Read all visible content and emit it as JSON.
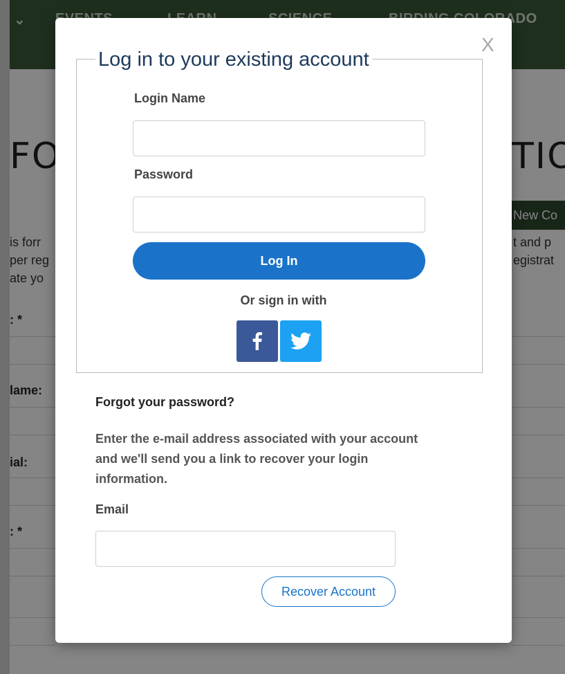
{
  "background": {
    "nav_items": [
      "EVENTS",
      "LEARN",
      "SCIENCE",
      "BIRDING COLORADO"
    ],
    "heading_left": "FO",
    "heading_right": "TIO",
    "new_button": "New Co",
    "text_left": [
      "is forr",
      "per reg",
      "ate yo"
    ],
    "text_right": [
      "t and p",
      "egistrat"
    ],
    "labels": [
      ": *",
      "lame:",
      "ial:",
      ": *"
    ]
  },
  "modal": {
    "close": "X",
    "login": {
      "legend": "Log in to your existing account",
      "login_name_label": "Login Name",
      "login_name_value": "",
      "password_label": "Password",
      "password_value": "",
      "login_button": "Log In",
      "or_sign_in": "Or sign in with",
      "social": [
        "facebook-icon",
        "twitter-icon"
      ]
    },
    "forgot": {
      "title": "Forgot your password?",
      "description": "Enter the e-mail address associated with your account and we'll send you a link to recover your login information.",
      "email_label": "Email",
      "email_value": "",
      "recover_button": "Recover Account"
    }
  },
  "colors": {
    "primary_blue": "#1a73c9",
    "facebook": "#3b5998",
    "twitter": "#1da1f2",
    "nav_green": "#3b5b3a"
  }
}
